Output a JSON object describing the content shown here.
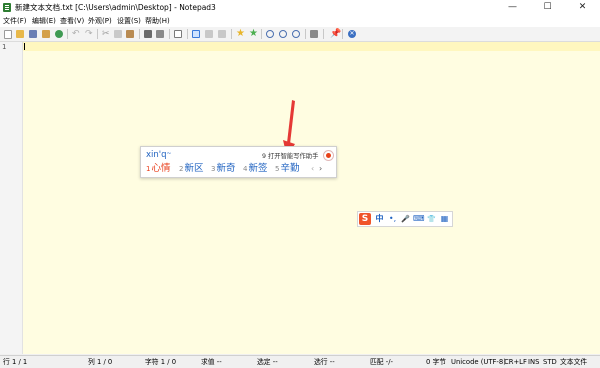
{
  "window": {
    "title": "新建文本文档.txt [C:\\Users\\admin\\Desktop] - Notepad3",
    "controls": {
      "minimize": "—",
      "maximize": "☐",
      "close": "✕"
    }
  },
  "menu": [
    "文件(F)",
    "编辑(E)",
    "查看(V)",
    "外观(P)",
    "设置(S)",
    "帮助(H)"
  ],
  "editor": {
    "line_number": "1",
    "text": ""
  },
  "ime": {
    "composition": "xin'q",
    "composition_suffix": "~",
    "hint": "9 打开智能写作助手",
    "candidates": [
      {
        "num": "1",
        "text": "心情"
      },
      {
        "num": "2",
        "text": "新区"
      },
      {
        "num": "3",
        "text": "新奇"
      },
      {
        "num": "4",
        "text": "新签"
      },
      {
        "num": "5",
        "text": "辛勤"
      }
    ],
    "prev": "‹",
    "next": "›"
  },
  "ime_toolbar": {
    "logo": "S",
    "lang": "中",
    "punct": "•,",
    "voice": "🎤",
    "keyboard": "⌨",
    "skin": "👕",
    "menu": "▦"
  },
  "status": {
    "line": "行 1 / 1",
    "col": "列 1 / 0",
    "char": "字符 1 / 0",
    "sum": "求值 --",
    "sel": "选定 --",
    "sel_lines": "选行 --",
    "match": "匹配 -/-",
    "bytes": "0 字节",
    "encoding": "Unicode (UTF-8)",
    "eol": "CR+LF",
    "ins": "INS",
    "std": "STD",
    "doc_type": "文本文件"
  },
  "colors": {
    "editor_bg": "#fffde1",
    "arrow": "#e53935",
    "ime_accent": "#1f62c0",
    "ime_selected": "#e83d1a"
  }
}
